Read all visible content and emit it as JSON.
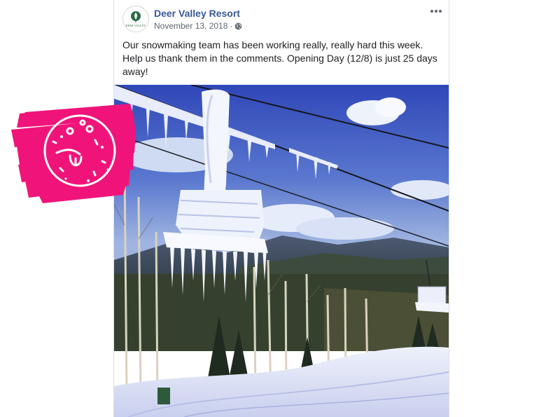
{
  "post": {
    "page_name": "Deer Valley Resort",
    "avatar_caption": "DEER VALLEY",
    "date": "November 13, 2018",
    "separator": "·",
    "text": "Our snowmaking team has been working really, really hard this week. Help us thank them in the comments. Opening Day (12/8) is just 25 days away!",
    "icons": {
      "more": "more-options-icon",
      "audience": "globe-icon",
      "avatar": "deer-valley-logo-icon"
    }
  },
  "photo": {
    "subject": "frozen-chairlift-photo"
  },
  "sticker": {
    "icon": "tongue-out-face-sticker",
    "color": "#f0147a"
  },
  "colors": {
    "link": "#385898",
    "meta": "#616770",
    "text": "#1c1e21",
    "border": "#dddfe2"
  }
}
